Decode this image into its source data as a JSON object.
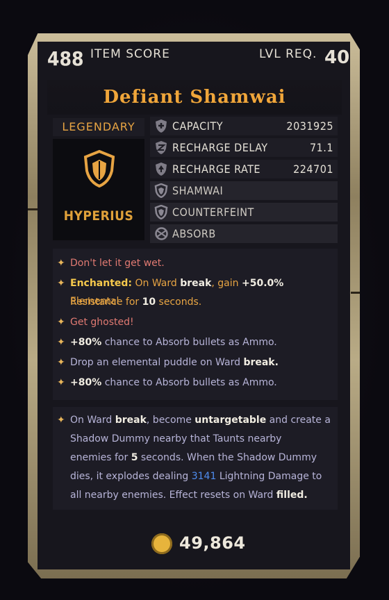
{
  "header": {
    "item_score": "488",
    "item_score_label": "ITEM SCORE",
    "level_label": "LVL REQ.",
    "level_value": "40"
  },
  "item": {
    "name": "Defiant Shamwai",
    "rarity": "LEGENDARY",
    "manufacturer": "HYPERIUS"
  },
  "stats": [
    {
      "label": "CAPACITY",
      "value": "2031925",
      "icon": "shield-plus-icon"
    },
    {
      "label": "RECHARGE DELAY",
      "value": "71.1",
      "icon": "shield-clock-icon"
    },
    {
      "label": "RECHARGE RATE",
      "value": "224701",
      "icon": "shield-arrow-icon"
    },
    {
      "label": "SHAMWAI",
      "value": "",
      "icon": "shield-icon"
    },
    {
      "label": "COUNTERFEINT",
      "value": "",
      "icon": "shield-icon"
    },
    {
      "label": "ABSORB",
      "value": "",
      "icon": "absorb-icon"
    }
  ],
  "perks": {
    "p1": "Don't let it get wet.",
    "p2_prefix": "Enchanted:",
    "p2_a": " On Ward ",
    "p2_b": "break",
    "p2_c": ", gain ",
    "p2_d": "+50.0%",
    "p2_e": " Elemental",
    "p2_line2_a": "Resistance for ",
    "p2_line2_b": "10",
    "p2_line2_c": " seconds.",
    "p3": "Get ghosted!",
    "p4_a": "+80%",
    "p4_b": " chance to Absorb bullets as Ammo.",
    "p5_a": "Drop an elemental puddle on Ward ",
    "p5_b": "break.",
    "p6_a": "+80%",
    "p6_b": " chance to Absorb bullets as Ammo."
  },
  "description": {
    "l1_a": "On Ward ",
    "l1_b": "break",
    "l1_c": ", become ",
    "l1_d": "untargetable",
    "l1_e": " and create a",
    "l2": "Shadow Dummy nearby that Taunts nearby",
    "l3_a": "enemies for ",
    "l3_b": "5",
    "l3_c": " seconds. When the Shadow Dummy",
    "l4_a": "dies, it explodes dealing ",
    "l4_b": "3141",
    "l4_c": " Lightning Damage to",
    "l5_a": "all nearby enemies. Effect resets on Ward ",
    "l5_b": "filled."
  },
  "footer": {
    "gold": "49,864"
  },
  "colors": {
    "legendary": "#e7a443",
    "title": "#f0a63a",
    "perk_red": "#e07a72",
    "perk_text": "#b7b4d8",
    "damage_blue": "#4f8df0"
  }
}
